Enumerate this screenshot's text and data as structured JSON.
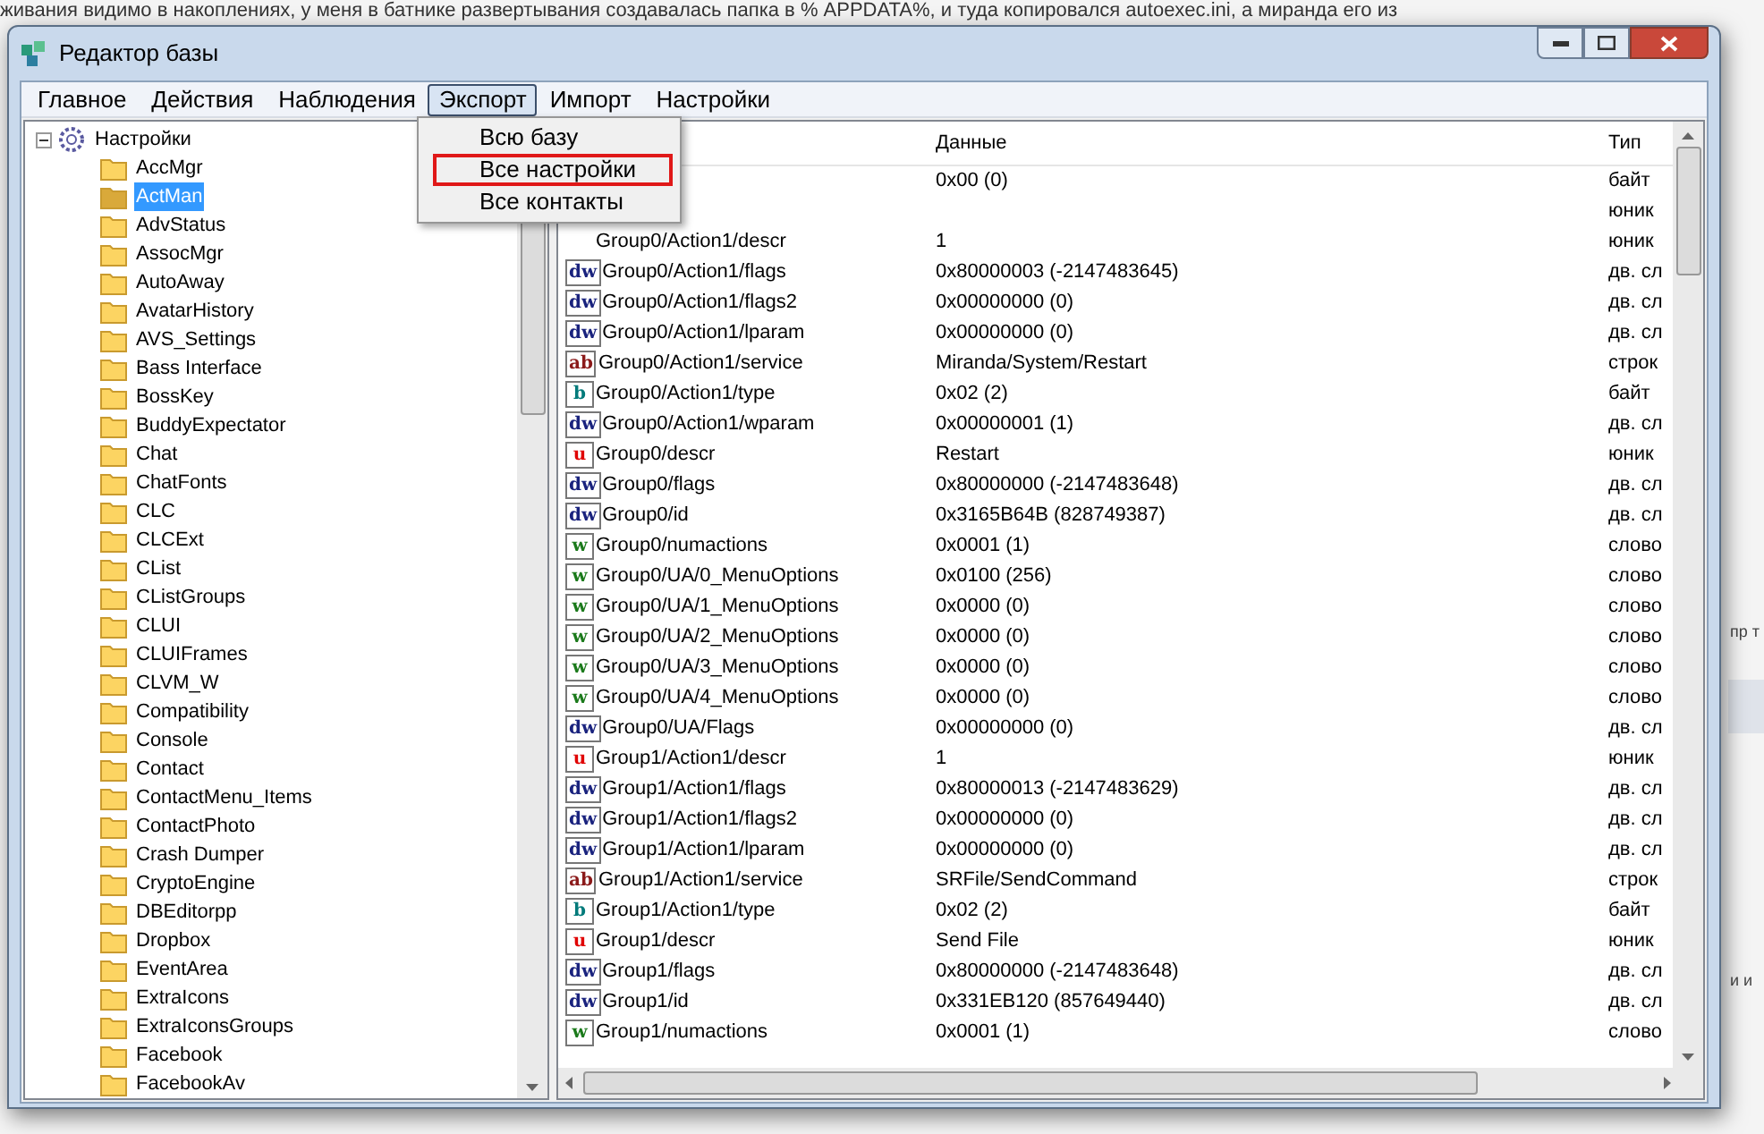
{
  "background": {
    "text_line": "живания видимо в накоплениях, у меня в батнике развертывания создавалась папка в % APPDATA%, и туда копировался autoexec.ini, а миранда его из",
    "side_texts": [
      "пр т",
      "и и"
    ]
  },
  "window": {
    "title": "Редактор базы"
  },
  "menu_bar": [
    {
      "label": "Главное",
      "selected": false
    },
    {
      "label": "Действия",
      "selected": false
    },
    {
      "label": "Наблюдения",
      "selected": false
    },
    {
      "label": "Экспорт",
      "selected": true
    },
    {
      "label": "Импорт",
      "selected": false
    },
    {
      "label": "Настройки",
      "selected": false
    }
  ],
  "dropdown": [
    {
      "label": "Всю базу",
      "outlined": false
    },
    {
      "label": "Все настройки",
      "outlined": true
    },
    {
      "label": "Все контакты",
      "outlined": false
    }
  ],
  "tree": {
    "label": "Настройки",
    "expanded": true,
    "children": [
      {
        "label": "AccMgr",
        "selected": false
      },
      {
        "label": "ActMan",
        "selected": true
      },
      {
        "label": "AdvStatus",
        "selected": false
      },
      {
        "label": "AssocMgr",
        "selected": false
      },
      {
        "label": "AutoAway",
        "selected": false
      },
      {
        "label": "AvatarHistory",
        "selected": false
      },
      {
        "label": "AVS_Settings",
        "selected": false
      },
      {
        "label": "Bass Interface",
        "selected": false
      },
      {
        "label": "BossKey",
        "selected": false
      },
      {
        "label": "BuddyExpectator",
        "selected": false
      },
      {
        "label": "Chat",
        "selected": false
      },
      {
        "label": "ChatFonts",
        "selected": false
      },
      {
        "label": "CLC",
        "selected": false
      },
      {
        "label": "CLCExt",
        "selected": false
      },
      {
        "label": "CList",
        "selected": false
      },
      {
        "label": "CListGroups",
        "selected": false
      },
      {
        "label": "CLUI",
        "selected": false
      },
      {
        "label": "CLUIFrames",
        "selected": false
      },
      {
        "label": "CLVM_W",
        "selected": false
      },
      {
        "label": "Compatibility",
        "selected": false
      },
      {
        "label": "Console",
        "selected": false
      },
      {
        "label": "Contact",
        "selected": false
      },
      {
        "label": "ContactMenu_Items",
        "selected": false
      },
      {
        "label": "ContactPhoto",
        "selected": false
      },
      {
        "label": "Crash Dumper",
        "selected": false
      },
      {
        "label": "CryptoEngine",
        "selected": false
      },
      {
        "label": "DBEditorpp",
        "selected": false
      },
      {
        "label": "Dropbox",
        "selected": false
      },
      {
        "label": "EventArea",
        "selected": false
      },
      {
        "label": "ExtraIcons",
        "selected": false
      },
      {
        "label": "ExtraIconsGroups",
        "selected": false
      },
      {
        "label": "Facebook",
        "selected": false
      },
      {
        "label": "FacebookAv",
        "selected": false
      }
    ]
  },
  "table": {
    "columns": [
      "Данные",
      "Тип"
    ],
    "rows": [
      {
        "data": "0x00 (0)",
        "type": "байт"
      },
      {
        "type": "юник"
      },
      {
        "name": "Group0/Action1/descr",
        "data": "1",
        "type": "юник"
      },
      {
        "kind": "dword",
        "badge": "dw",
        "name": "Group0/Action1/flags",
        "data": "0x80000003 (-2147483645)",
        "type": "дв. сл"
      },
      {
        "kind": "dword",
        "badge": "dw",
        "name": "Group0/Action1/flags2",
        "data": "0x00000000 (0)",
        "type": "дв. сл"
      },
      {
        "kind": "dword",
        "badge": "dw",
        "name": "Group0/Action1/lparam",
        "data": "0x00000000 (0)",
        "type": "дв. сл"
      },
      {
        "kind": "string",
        "badge": "ab",
        "name": "Group0/Action1/service",
        "data": "Miranda/System/Restart",
        "type": "строк"
      },
      {
        "kind": "byte",
        "badge": "b",
        "name": "Group0/Action1/type",
        "data": "0x02 (2)",
        "type": "байт"
      },
      {
        "kind": "dword",
        "badge": "dw",
        "name": "Group0/Action1/wparam",
        "data": "0x00000001 (1)",
        "type": "дв. сл"
      },
      {
        "kind": "unicode",
        "badge": "u",
        "name": "Group0/descr",
        "data": "Restart",
        "type": "юник"
      },
      {
        "kind": "dword",
        "badge": "dw",
        "name": "Group0/flags",
        "data": "0x80000000 (-2147483648)",
        "type": "дв. сл"
      },
      {
        "kind": "dword",
        "badge": "dw",
        "name": "Group0/id",
        "data": "0x3165B64B (828749387)",
        "type": "дв. сл"
      },
      {
        "kind": "word",
        "badge": "w",
        "name": "Group0/numactions",
        "data": "0x0001 (1)",
        "type": "слово"
      },
      {
        "kind": "word",
        "badge": "w",
        "name": "Group0/UA/0_MenuOptions",
        "data": "0x0100 (256)",
        "type": "слово"
      },
      {
        "kind": "word",
        "badge": "w",
        "name": "Group0/UA/1_MenuOptions",
        "data": "0x0000 (0)",
        "type": "слово"
      },
      {
        "kind": "word",
        "badge": "w",
        "name": "Group0/UA/2_MenuOptions",
        "data": "0x0000 (0)",
        "type": "слово"
      },
      {
        "kind": "word",
        "badge": "w",
        "name": "Group0/UA/3_MenuOptions",
        "data": "0x0000 (0)",
        "type": "слово"
      },
      {
        "kind": "word",
        "badge": "w",
        "name": "Group0/UA/4_MenuOptions",
        "data": "0x0000 (0)",
        "type": "слово"
      },
      {
        "kind": "dword",
        "badge": "dw",
        "name": "Group0/UA/Flags",
        "data": "0x00000000 (0)",
        "type": "дв. сл"
      },
      {
        "kind": "unicode",
        "badge": "u",
        "name": "Group1/Action1/descr",
        "data": "1",
        "type": "юник"
      },
      {
        "kind": "dword",
        "badge": "dw",
        "name": "Group1/Action1/flags",
        "data": "0x80000013 (-2147483629)",
        "type": "дв. сл"
      },
      {
        "kind": "dword",
        "badge": "dw",
        "name": "Group1/Action1/flags2",
        "data": "0x00000000 (0)",
        "type": "дв. сл"
      },
      {
        "kind": "dword",
        "badge": "dw",
        "name": "Group1/Action1/lparam",
        "data": "0x00000000 (0)",
        "type": "дв. сл"
      },
      {
        "kind": "string",
        "badge": "ab",
        "name": "Group1/Action1/service",
        "data": "SRFile/SendCommand",
        "type": "строк"
      },
      {
        "kind": "byte",
        "badge": "b",
        "name": "Group1/Action1/type",
        "data": "0x02 (2)",
        "type": "байт"
      },
      {
        "kind": "unicode",
        "badge": "u",
        "name": "Group1/descr",
        "data": "Send File",
        "type": "юник"
      },
      {
        "kind": "dword",
        "badge": "dw",
        "name": "Group1/flags",
        "data": "0x80000000 (-2147483648)",
        "type": "дв. сл"
      },
      {
        "kind": "dword",
        "badge": "dw",
        "name": "Group1/id",
        "data": "0x331EB120 (857649440)",
        "type": "дв. сл"
      },
      {
        "kind": "word",
        "badge": "w",
        "name": "Group1/numactions",
        "data": "0x0001 (1)",
        "type": "слово"
      }
    ]
  }
}
